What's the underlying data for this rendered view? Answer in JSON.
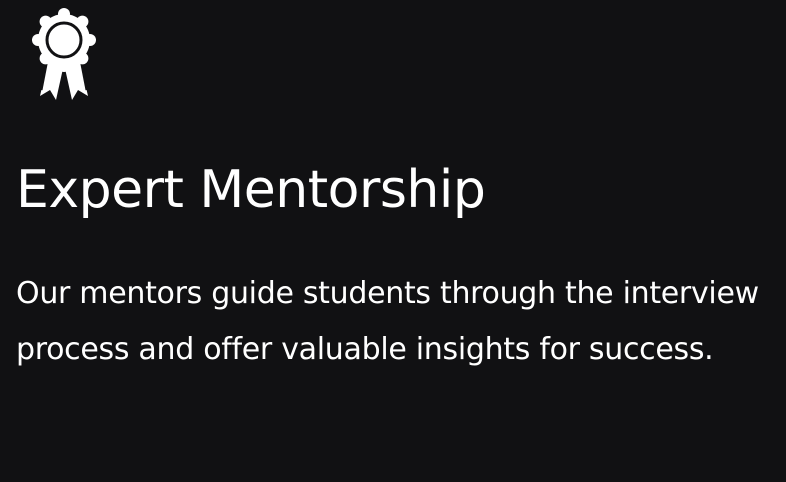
{
  "feature": {
    "icon": "award-ribbon-icon",
    "title": "Expert Mentorship",
    "description": "Our mentors guide students through the interview process and offer valuable insights for success."
  },
  "colors": {
    "background": "#111113",
    "text": "#ffffff"
  }
}
